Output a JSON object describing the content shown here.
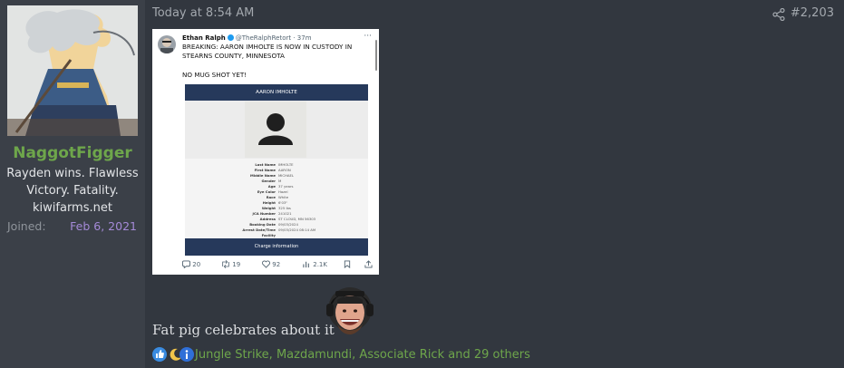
{
  "user": {
    "username": "NaggotFigger",
    "title": "Rayden wins. Flawless Victory. Fatality. kiwifarms.net",
    "joined_label": "Joined:",
    "joined_value": "Feb 6, 2021"
  },
  "post": {
    "timestamp": "Today at 8:54 AM",
    "number": "#2,203",
    "text": "Fat pig celebrates about it",
    "reactions_text": "Jungle Strike, Mazdamundi, Associate Rick and 29 others"
  },
  "tweet": {
    "author": "Ethan Ralph",
    "handle": "@TheRalphRetort · 37m",
    "text": "BREAKING: AARON IMHOLTE IS NOW IN CUSTODY IN STEARNS COUNTY, MINNESOTA",
    "text2": "NO MUG SHOT YET!",
    "card_header": "AARON IMHOLTE",
    "card_footer": "Charge information",
    "card_rows": [
      {
        "k": "Last Name",
        "v": "IMHOLTE"
      },
      {
        "k": "First Name",
        "v": "AARON"
      },
      {
        "k": "Middle Name",
        "v": "MICHAEL"
      },
      {
        "k": "Gender",
        "v": "M"
      },
      {
        "k": "Age",
        "v": "37 years"
      },
      {
        "k": "Eye Color",
        "v": "Hazel"
      },
      {
        "k": "Race",
        "v": "White"
      },
      {
        "k": "Height",
        "v": "6'03\""
      },
      {
        "k": "Weight",
        "v": "325 lbs"
      },
      {
        "k": "JCA Number",
        "v": "241021"
      },
      {
        "k": "Address",
        "v": "ST CLOUD, MN 56303"
      },
      {
        "k": "Booking Date",
        "v": "09/03/2024"
      },
      {
        "k": "Arrest Date/Time",
        "v": "09/03/2024 08:14 AM"
      },
      {
        "k": "Facility",
        "v": ""
      }
    ],
    "replies": "20",
    "retweets": "19",
    "likes": "92",
    "views": "2.1K"
  },
  "icons": {
    "share": "share-icon",
    "reactions": [
      "like-icon",
      "moon-icon",
      "info-icon"
    ]
  },
  "colors": {
    "background": "#32373f",
    "sidebar": "#3b4048",
    "username": "#6ea64b",
    "joined": "#a58ad8",
    "card_navy": "#26395b"
  }
}
